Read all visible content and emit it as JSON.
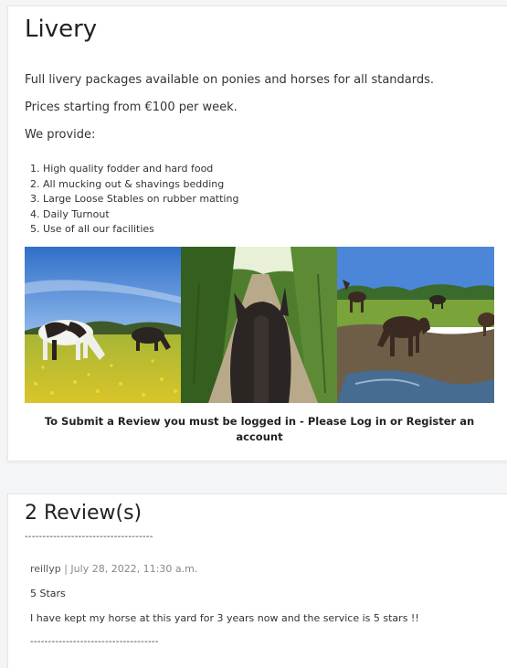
{
  "livery": {
    "title": "Livery",
    "intro": "Full livery packages available on ponies and horses for all standards.",
    "price": "Prices starting from €100 per week.",
    "provide_heading": "We provide:",
    "provide_items": [
      "High quality fodder and hard food",
      "All mucking out & shavings bedding",
      "Large Loose Stables on rubber matting",
      "Daily Turnout",
      "Use of all our facilities"
    ],
    "photos": [
      {
        "name": "piebald-horse-in-buttercup-field-photo"
      },
      {
        "name": "horseback-trail-ride-photo"
      },
      {
        "name": "horses-in-paddock-photo"
      }
    ],
    "login_notice": "To Submit a Review you must be logged in - Please Log in or Register an account"
  },
  "reviews": {
    "title": "2 Review(s)",
    "separator": "------------------------------------",
    "items": [
      {
        "user": "reillyp",
        "divider": " | ",
        "date": "July 28, 2022, 11:30 a.m.",
        "rating": "5 Stars",
        "text": "I have kept my horse at this yard for 3 years now and the service is 5 stars !!",
        "separator": "------------------------------------"
      }
    ]
  }
}
